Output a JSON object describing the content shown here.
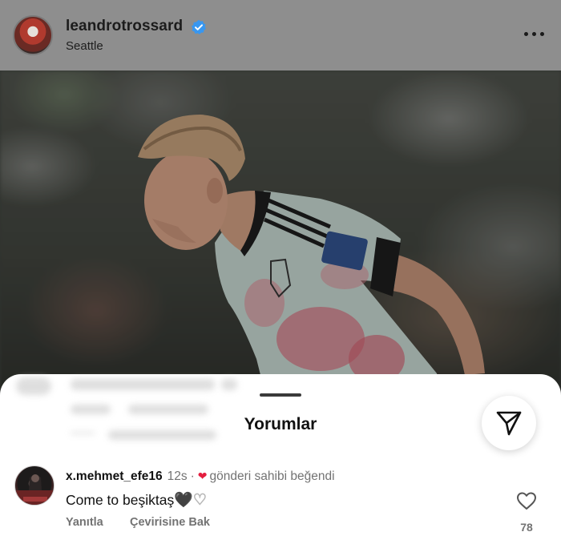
{
  "post": {
    "username": "leandrotrossard",
    "location": "Seattle",
    "verified": true,
    "more_icon": "more-horizontal-icon"
  },
  "sheet": {
    "title": "Yorumlar",
    "send_icon": "paper-plane-icon"
  },
  "comment": {
    "username": "x.mehmet_efe16",
    "time": "12s",
    "separator": "·",
    "liked_by_author_label": "gönderi sahibi beğendi",
    "text": "Come to beşiktaş",
    "emoji_black_heart": "🖤",
    "emoji_white_heart": "♡",
    "reply_label": "Yanıtla",
    "translate_label": "Çevirisine Bak",
    "like_count": "78"
  },
  "colors": {
    "verified": "#3897f0",
    "liked_heart": "#e41e3f",
    "muted_text": "#737373"
  }
}
